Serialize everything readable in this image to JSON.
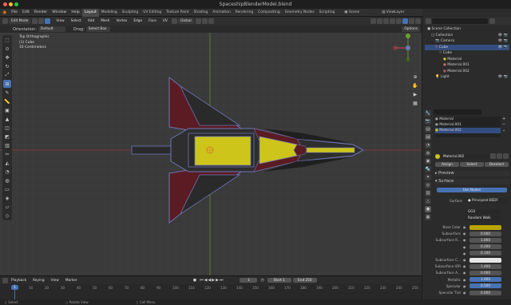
{
  "title": "SpaceshipBlenderModel.blend",
  "menu": [
    "File",
    "Edit",
    "Render",
    "Window",
    "Help"
  ],
  "workspaces": [
    "Layout",
    "Modeling",
    "Sculpting",
    "UV Editing",
    "Texture Paint",
    "Shading",
    "Animation",
    "Rendering",
    "Compositing",
    "Geometry Nodes",
    "Scripting"
  ],
  "scene_name": "Scene",
  "viewlayer_name": "ViewLayer",
  "viewport_header": {
    "mode": "Edit Mode",
    "menus": [
      "View",
      "Select",
      "Add",
      "Mesh",
      "Vertex",
      "Edge",
      "Face",
      "UV"
    ],
    "transform_orientation": "Global",
    "orientation_label": "Orientation:",
    "orientation_value": "Default",
    "drag_label": "Drag:",
    "drag_value": "Select Box",
    "options": "Options"
  },
  "overlay_text": {
    "view": "Top Orthographic",
    "object": "(1) Cube",
    "scale": "10 Centimeters"
  },
  "outliner": {
    "items": [
      {
        "label": "Scene Collection",
        "indent": 0
      },
      {
        "label": "Collection",
        "indent": 1
      },
      {
        "label": "Camera",
        "indent": 2
      },
      {
        "label": "Cube",
        "indent": 2,
        "selected": true
      },
      {
        "label": "Cube",
        "indent": 3
      },
      {
        "label": "Material",
        "indent": 4
      },
      {
        "label": "Material.001",
        "indent": 4
      },
      {
        "label": "Material.002",
        "indent": 4
      },
      {
        "label": "Light",
        "indent": 2
      }
    ]
  },
  "material_slots": [
    "Material",
    "Material.001",
    "Material.002"
  ],
  "active_material": "Material.002",
  "slot_buttons": {
    "assign": "Assign",
    "select": "Select",
    "deselect": "Deselect"
  },
  "panels": {
    "preview": "Preview",
    "surface": "Surface"
  },
  "use_nodes": "Use Nodes",
  "surface_shader": "Principled BSDF",
  "surface_label": "Surface",
  "properties": {
    "distribution": "GGX",
    "subsurface_method": "Random Walk",
    "rows": [
      {
        "label": "Base Color",
        "type": "color",
        "color": "#b8a500"
      },
      {
        "label": "Subsurface",
        "value": "0.000"
      },
      {
        "label": "Subsurface R...",
        "value": "1.000"
      },
      {
        "label": "",
        "value": "0.200"
      },
      {
        "label": "",
        "value": "0.100"
      },
      {
        "label": "Subsurface C...",
        "type": "color",
        "color": "#e6e6e6"
      },
      {
        "label": "Subsurface IOR",
        "value": "1.400"
      },
      {
        "label": "Subsurface A...",
        "value": "0.000"
      },
      {
        "label": "Metallic",
        "value": "1.000",
        "highlight": true
      },
      {
        "label": "Specular",
        "value": "0.500",
        "highlight": true
      },
      {
        "label": "Specular Tint",
        "value": "0.000"
      }
    ]
  },
  "timeline": {
    "menus": [
      "Playback",
      "Keying",
      "View",
      "Marker"
    ],
    "current_frame": "1",
    "start_label": "Start",
    "start": "1",
    "end_label": "End",
    "end": "250",
    "ticks": [
      "0",
      "10",
      "20",
      "30",
      "40",
      "50",
      "60",
      "70",
      "80",
      "90",
      "100",
      "110",
      "120",
      "130",
      "140",
      "150",
      "160",
      "170",
      "180",
      "190",
      "200",
      "210",
      "220",
      "230",
      "240",
      "250"
    ]
  },
  "statusbar": {
    "select": "Select",
    "rotate": "Rotate View",
    "menu": "Call Menu"
  },
  "colors": {
    "accent": "#4772b3",
    "ship_yellow": "#cdc51a",
    "ship_dark": "#2a2a2a",
    "ship_red": "#5a1c22",
    "edge": "#6d75b8"
  }
}
